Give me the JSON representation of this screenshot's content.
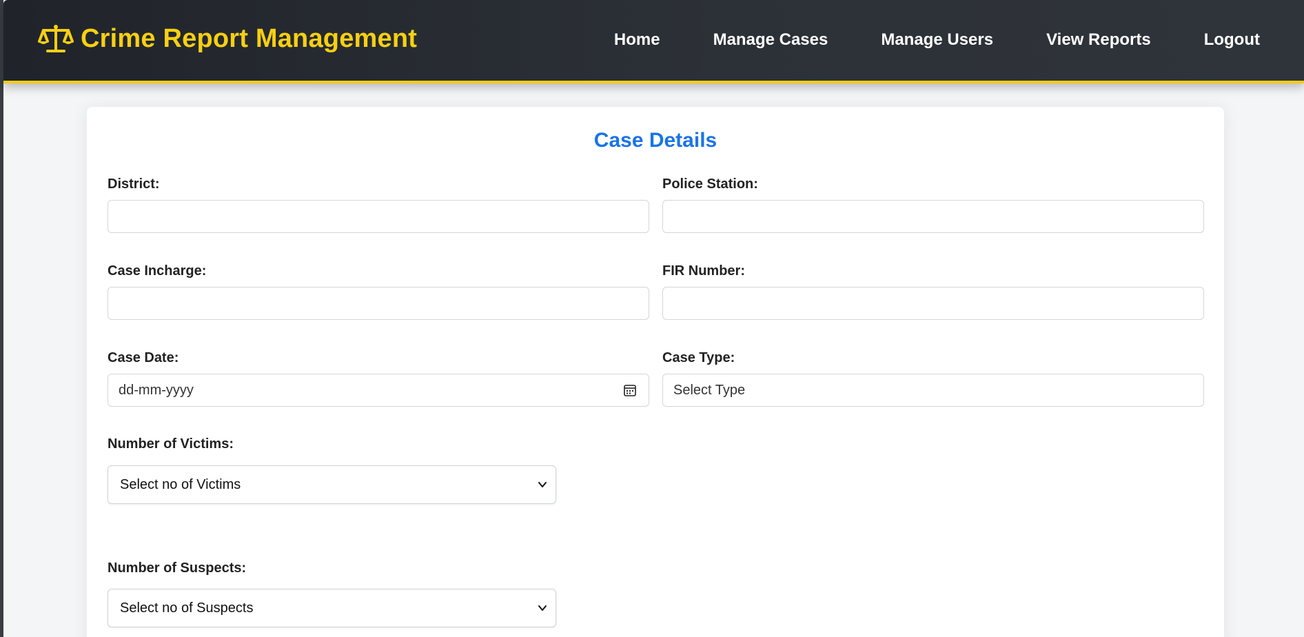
{
  "app": {
    "title": "Crime Report Management",
    "brand_icon": "scales-of-justice-icon"
  },
  "nav": {
    "items": [
      {
        "label": "Home"
      },
      {
        "label": "Manage Cases"
      },
      {
        "label": "Manage Users"
      },
      {
        "label": "View Reports"
      },
      {
        "label": "Logout"
      }
    ]
  },
  "form": {
    "title": "Case Details",
    "district": {
      "label": "District:",
      "value": ""
    },
    "police_station": {
      "label": "Police Station:",
      "value": ""
    },
    "case_incharge": {
      "label": "Case Incharge:",
      "value": ""
    },
    "fir_number": {
      "label": "FIR Number:",
      "value": ""
    },
    "case_date": {
      "label": "Case Date:",
      "placeholder": "dd-mm-yyyy"
    },
    "case_type": {
      "label": "Case Type:",
      "placeholder": "Select Type"
    },
    "victims": {
      "label": "Number of Victims:",
      "selected": "Select no of Victims"
    },
    "suspects": {
      "label": "Number of Suspects:",
      "selected": "Select no of Suspects"
    }
  },
  "colors": {
    "brand_yellow": "#f7cf14",
    "accent_blue": "#1a73e8",
    "navbar_dark": "#2c3137"
  }
}
